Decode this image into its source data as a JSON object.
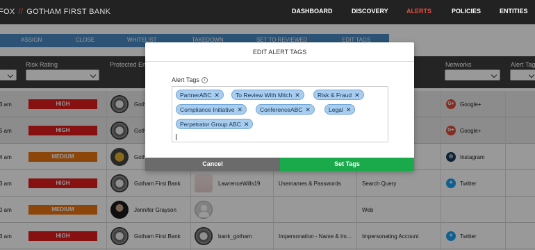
{
  "header": {
    "brand_left": "FOX",
    "brand_sep": "//",
    "brand_name": "GOTHAM FIRST BANK",
    "nav": [
      "DASHBOARD",
      "DISCOVERY",
      "ALERTS",
      "POLICIES",
      "ENTITIES"
    ],
    "active_nav": "ALERTS",
    "active_color": "#e74c3c"
  },
  "actions": [
    "ASSIGN",
    "CLOSE",
    "WHITELIST",
    "TAKEDOWN",
    "SET TO REVIEWED",
    "EDIT TAGS"
  ],
  "table": {
    "columns": [
      "Risk Rating",
      "Protected En",
      "Networks",
      "Alert Tag"
    ],
    "rows": [
      {
        "time": "3 am",
        "risk": "HIGH",
        "entity": "Goth",
        "col3": "",
        "col4": "",
        "col5": "",
        "network": "Google+"
      },
      {
        "time": "5 am",
        "risk": "HIGH",
        "entity": "Goth",
        "col3": "",
        "col4": "",
        "col5": "",
        "network": "Google+"
      },
      {
        "time": "4 am",
        "risk": "MEDIUM",
        "entity": "Goth",
        "col3": "",
        "col4": "",
        "col5": "",
        "network": "Instagram"
      },
      {
        "time": "3 am",
        "risk": "HIGH",
        "entity": "Gotham First Bank",
        "col3": "LawrenceWills19",
        "col4": "Usernames & Passwords",
        "col5": "Search Query",
        "network": "Twitter"
      },
      {
        "time": "0 am",
        "risk": "MEDIUM",
        "entity": "Jennifer Grayson",
        "col3": "",
        "col4": "",
        "col5": "Web",
        "network": ""
      },
      {
        "time": "3 am",
        "risk": "HIGH",
        "entity": "Gotham First Bank",
        "col3": "bank_gotham",
        "col4": "Impersonation - Name & Im...",
        "col5": "Impersonating Account",
        "network": "Twitter"
      }
    ]
  },
  "modal": {
    "title": "EDIT ALERT TAGS",
    "label": "Alert Tags",
    "info_glyph": "i",
    "tags": [
      "PartnerABC",
      "To Review With Mitch",
      "Risk & Fraud",
      "Compliance Initiative",
      "ConferenceABC",
      "Legal",
      "Perpetrator Group ABC"
    ],
    "remove_glyph": "✕",
    "cancel": "Cancel",
    "submit": "Set Tags",
    "colors": {
      "tag_bg": "#a9cdee",
      "submit": "#1aaa4b",
      "cancel": "#6b6b6b"
    }
  },
  "icons": {
    "google": "G+",
    "instagram": "◎",
    "twitter": "✦"
  }
}
